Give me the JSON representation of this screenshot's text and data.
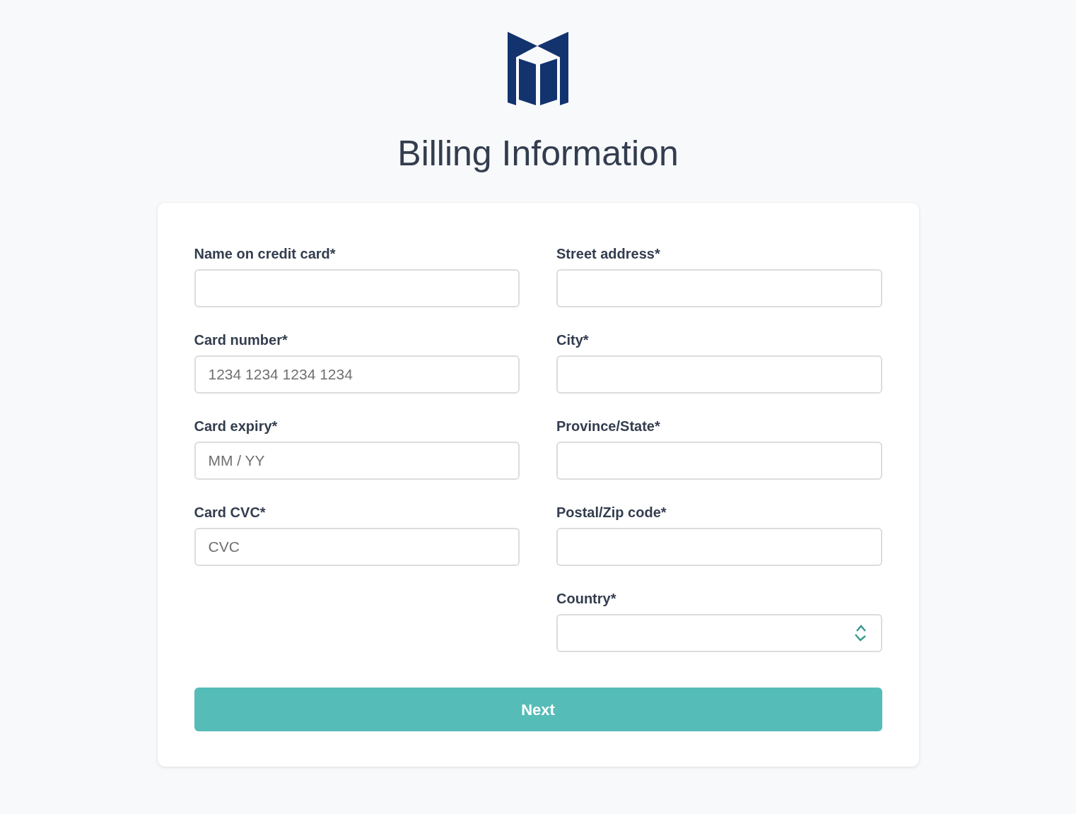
{
  "title": "Billing Information",
  "columns": [
    [
      {
        "kind": "text",
        "label": "Name on credit card*"
      },
      {
        "kind": "text",
        "label": "Card number*",
        "placeholder": "1234 1234 1234 1234"
      },
      {
        "kind": "text",
        "label": "Card expiry*",
        "placeholder": "MM / YY"
      },
      {
        "kind": "text",
        "label": "Card CVC*",
        "placeholder": "CVC"
      }
    ],
    [
      {
        "kind": "text",
        "label": "Street address*"
      },
      {
        "kind": "text",
        "label": "City*"
      },
      {
        "kind": "text",
        "label": "Province/State*"
      },
      {
        "kind": "text",
        "label": "Postal/Zip code*"
      },
      {
        "kind": "select",
        "label": "Country*"
      }
    ]
  ],
  "button": "Next"
}
